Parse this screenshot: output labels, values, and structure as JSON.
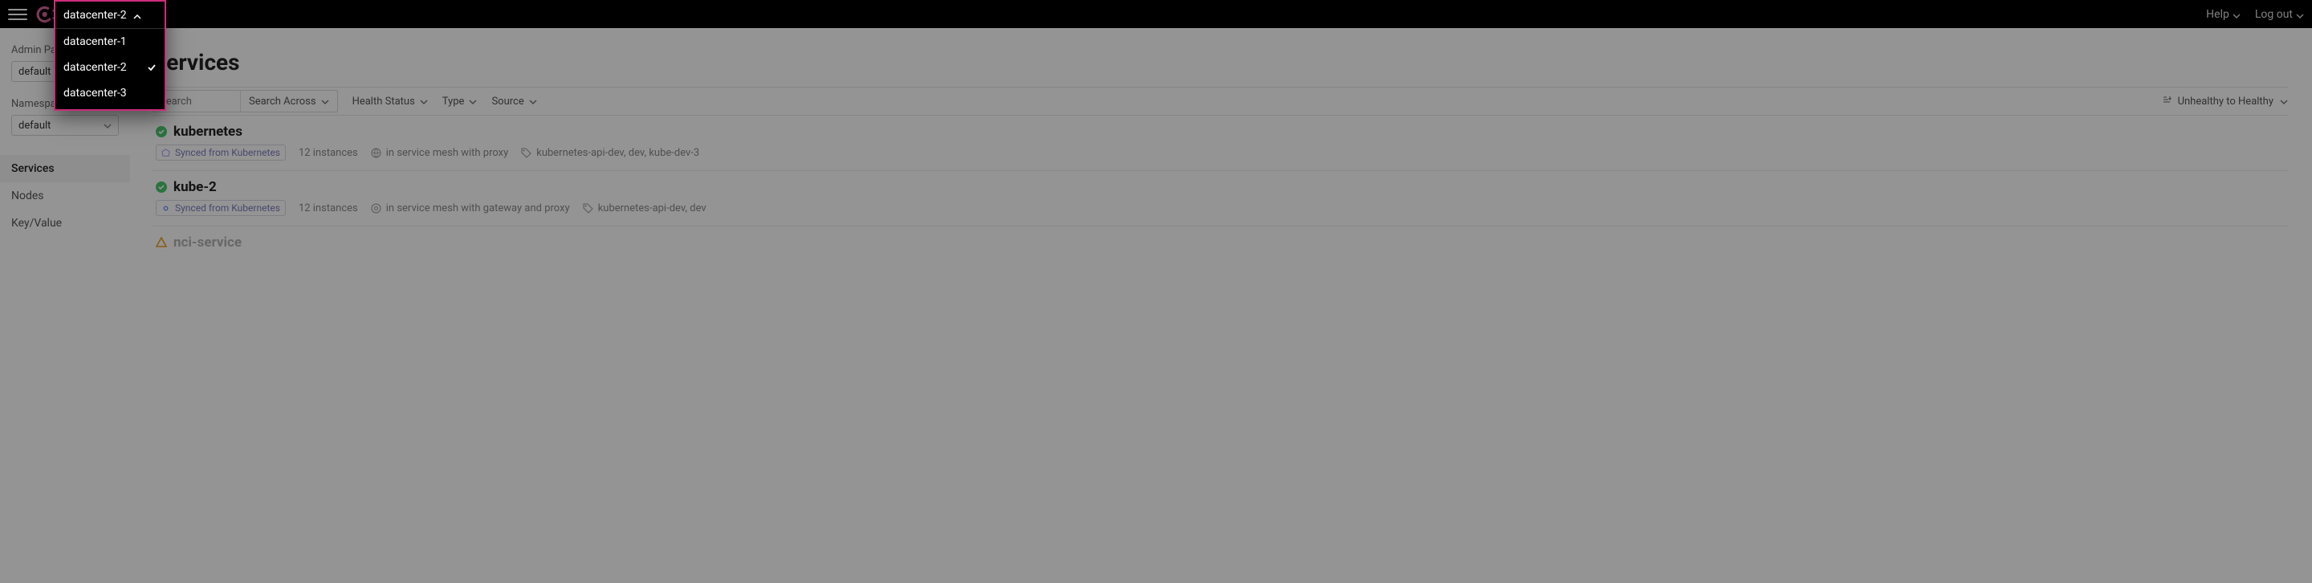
{
  "topbar": {
    "help": "Help",
    "logout": "Log out"
  },
  "datacenter": {
    "current": "datacenter-2",
    "options": [
      "datacenter-1",
      "datacenter-2",
      "datacenter-3"
    ],
    "selected_index": 1
  },
  "sidebar": {
    "admin_partition_label": "Admin Partition",
    "admin_partition_value": "default",
    "namespace_label": "Namespace",
    "namespace_value": "default",
    "nav": {
      "services": "Services",
      "nodes": "Nodes",
      "keyvalue": "Key/Value"
    }
  },
  "page": {
    "title": "Services",
    "search_placeholder": "Search",
    "search_across": "Search Across",
    "filter_health": "Health Status",
    "filter_type": "Type",
    "filter_source": "Source",
    "sort_label": "Unhealthy to Healthy"
  },
  "services": [
    {
      "name": "kubernetes",
      "status": "ok",
      "synced_badge": "Synced from Kubernetes",
      "synced_style": "purple",
      "instances": "12 instances",
      "mesh": "in service mesh with proxy",
      "tags": "kubernetes-api-dev, dev, kube-dev-3"
    },
    {
      "name": "kube-2",
      "status": "ok",
      "synced_badge": "Synced from Kubernetes",
      "synced_style": "blue",
      "instances": "12 instances",
      "mesh": "in service mesh with gateway and proxy",
      "tags": "kubernetes-api-dev, dev"
    },
    {
      "name": "nci-service",
      "status": "warn"
    }
  ]
}
